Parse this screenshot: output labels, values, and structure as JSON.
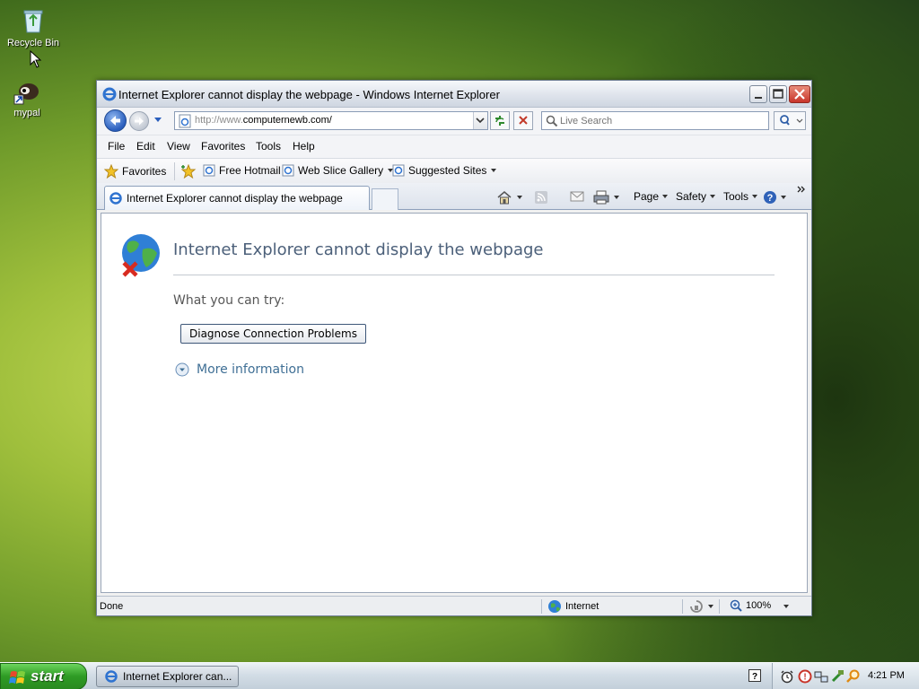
{
  "desktop": {
    "icons": [
      {
        "label": "Recycle Bin",
        "icon": "recycle-bin-icon"
      },
      {
        "label": "mypal",
        "icon": "mypal-icon"
      }
    ]
  },
  "window": {
    "title": "Internet Explorer cannot display the webpage - Windows Internet Explorer",
    "address": {
      "prefix": "http://www.",
      "host": "computernewb.com/"
    },
    "search_placeholder": "Live Search"
  },
  "menu": [
    "File",
    "Edit",
    "View",
    "Favorites",
    "Tools",
    "Help"
  ],
  "favorites_bar": {
    "favorites_label": "Favorites",
    "items": [
      "Free Hotmail",
      "Web Slice Gallery",
      "Suggested Sites"
    ]
  },
  "tab": {
    "label": "Internet Explorer cannot display the webpage"
  },
  "command_bar": {
    "page": "Page",
    "safety": "Safety",
    "tools": "Tools"
  },
  "page": {
    "title": "Internet Explorer cannot display the webpage",
    "try_label": "What you can try:",
    "diagnose_button": "Diagnose Connection Problems",
    "more_info": "More information"
  },
  "status": {
    "text": "Done",
    "zone": "Internet",
    "zoom": "100%"
  },
  "taskbar": {
    "start_label": "start",
    "task_label": "Internet Explorer can...",
    "clock": "4:21 PM"
  }
}
